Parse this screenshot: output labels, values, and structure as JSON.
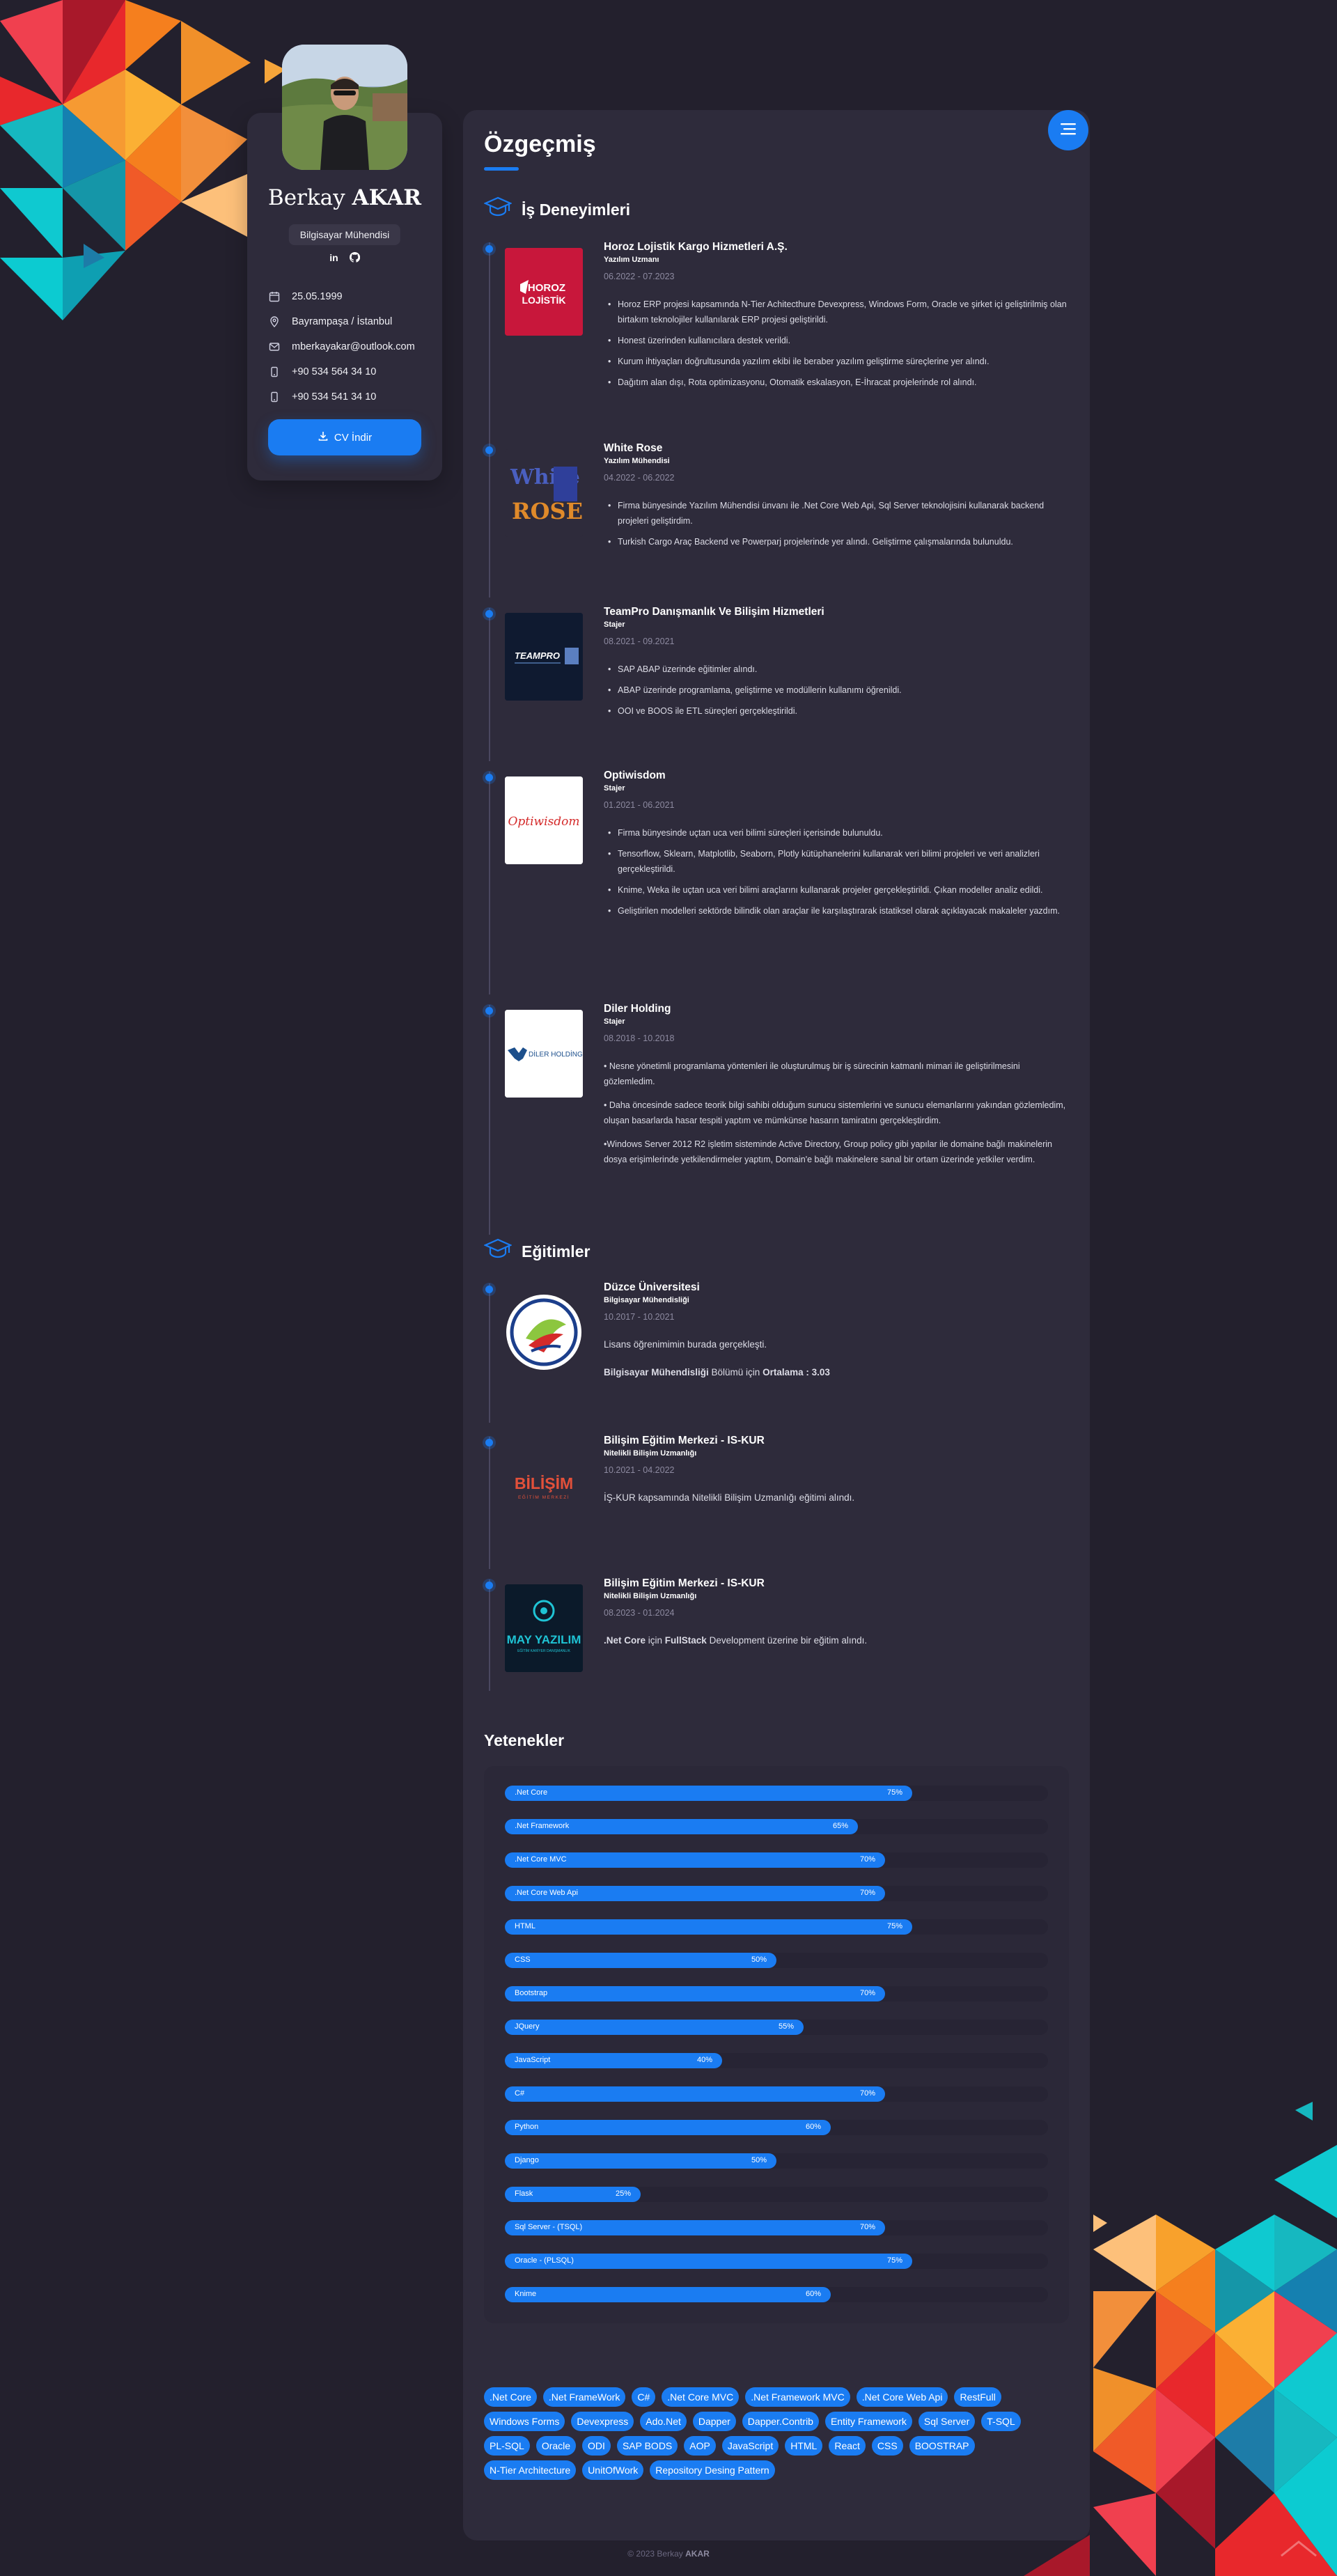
{
  "profile": {
    "first_name": "Berkay",
    "last_name": "AKAR",
    "title": "Bilgisayar Mühendisi",
    "birth": "25.05.1999",
    "location": "Bayrampaşa / İstanbul",
    "email": "mberkayakar@outlook.com",
    "phone1": "+90 534 564 34 10",
    "phone2": "+90 534 541 34 10",
    "cv_button": "CV İndir",
    "social_linkedin": "in",
    "social_github": "github"
  },
  "main": {
    "title": "Özgeçmiş",
    "experience_heading": "İş Deneyimleri",
    "education_heading": "Eğitimler",
    "skills_heading": "Yetenekler"
  },
  "experience": [
    {
      "company": "Horoz Lojistik Kargo Hizmetleri A.Ş.",
      "role": "Yazılım Uzmanı",
      "date": "06.2022 - 07.2023",
      "logo_text": "HOROZ LOJİSTİK",
      "items": [
        "Horoz ERP projesi kapsamında N-Tier Achitecthure Devexpress, Windows Form, Oracle ve şirket içi geliştirilmiş olan birtakım teknolojiler kullanılarak ERP projesi geliştirildi.",
        "Honest üzerinden kullanıcılara destek verildi.",
        "Kurum ihtiyaçları doğrultusunda yazılım ekibi ile beraber yazılım geliştirme süreçlerine yer alındı.",
        "Dağıtım alan dışı, Rota optimizasyonu, Otomatik eskalasyon, E-İhracat projelerinde rol alındı."
      ]
    },
    {
      "company": "White Rose",
      "role": "Yazılım Mühendisi",
      "date": "04.2022 - 06.2022",
      "logo_text": "White ROSE",
      "items": [
        "Firma bünyesinde Yazılım Mühendisi ünvanı ile .Net Core Web Api, Sql Server teknolojisini kullanarak backend projeleri geliştirdim.",
        "Turkish Cargo Araç Backend ve Powerparj projelerinde yer alındı. Geliştirme çalışmalarında bulunuldu."
      ]
    },
    {
      "company": "TeamPro Danışmanlık Ve Bilişim Hizmetleri",
      "role": "Stajer",
      "date": "08.2021 - 09.2021",
      "logo_text": "TEAMPRO",
      "items": [
        "SAP ABAP üzerinde eğitimler alındı.",
        "ABAP üzerinde programlama, geliştirme ve modüllerin kullanımı öğrenildi.",
        "OOI ve BOOS ile ETL süreçleri gerçekleştirildi."
      ]
    },
    {
      "company": "Optiwisdom",
      "role": "Stajer",
      "date": "01.2021 - 06.2021",
      "logo_text": "Optiwisdom",
      "items": [
        "Firma bünyesinde uçtan uca veri bilimi süreçleri içerisinde bulunuldu.",
        "Tensorflow, Sklearn, Matplotlib, Seaborn, Plotly kütüphanelerini kullanarak veri bilimi projeleri ve veri analizleri gerçekleştirildi.",
        "Knime, Weka ile uçtan uca veri bilimi araçlarını kullanarak projeler gerçekleştirildi. Çıkan modeller analiz edildi.",
        "Geliştirilen modelleri sektörde bilindik olan araçlar ile karşılaştırarak istatiksel olarak açıklayacak makaleler yazdım."
      ]
    },
    {
      "company": "Diler Holding",
      "role": "Stajer",
      "date": "08.2018 - 10.2018",
      "logo_text": "DİLER HOLDİNG",
      "paras": [
        "• Nesne yönetimli programlama yöntemleri ile oluşturulmuş bir iş sürecinin katmanlı mimari ile geliştirilmesini gözlemledim.",
        "• Daha öncesinde sadece teorik bilgi sahibi olduğum sunucu sistemlerini ve sunucu elemanlarını yakından gözlemledim, oluşan basarlarda hasar tespiti yaptım ve mümkünse hasarın tamiratını gerçekleştirdim.",
        "•Windows Server 2012 R2 işletim sisteminde Active Directory, Group policy gibi yapılar ile domaine bağlı makinelerin dosya erişimlerinde yetkilendirmeler yaptım, Domain'e bağlı makinelere sanal bir ortam üzerinde yetkiler verdim."
      ]
    }
  ],
  "education": [
    {
      "school": "Düzce Üniversitesi",
      "role": "Bilgisayar Mühendisliği",
      "date": "10.2017 - 10.2021",
      "logo_text": "DÜZCE ÜNİVERSİTESİ",
      "p1": "Lisans öğrenimimin burada gerçekleşti.",
      "p2_a": "Bilgisayar Mühendisliği",
      "p2_b": " Bölümü için ",
      "p2_c": "Ortalama : 3.03"
    },
    {
      "school": "Bilişim Eğitim Merkezi - IS-KUR",
      "role": "Nitelikli Bilişim Uzmanlığı",
      "date": "10.2021 - 04.2022",
      "logo_text": "BİLİŞİM",
      "logo_sub": "EĞİTİM MERKEZİ",
      "p1": "İŞ-KUR kapsamında Nitelikli Bilişim Uzmanlığı eğitimi alındı."
    },
    {
      "school": "Bilişim Eğitim Merkezi - IS-KUR",
      "role": "Nitelikli Bilişim Uzmanlığı",
      "date": "08.2023 - 01.2024",
      "logo_text": "MAY YAZILIM",
      "logo_sub": "EĞİTİM KARİYER DANIŞMANLIK",
      "p1_a": ".Net Core",
      "p1_b": " için ",
      "p1_c": "FullStack",
      "p1_d": " Development üzerine bir eğitim alındı."
    }
  ],
  "skills": [
    {
      "name": ".Net Core",
      "pct": 75,
      "label": "75%"
    },
    {
      "name": ".Net Framework",
      "pct": 65,
      "label": "65%"
    },
    {
      "name": ".Net Core MVC",
      "pct": 70,
      "label": "70%"
    },
    {
      "name": ".Net Core Web Api",
      "pct": 70,
      "label": "70%"
    },
    {
      "name": "HTML",
      "pct": 75,
      "label": "75%"
    },
    {
      "name": "CSS",
      "pct": 50,
      "label": "50%"
    },
    {
      "name": "Bootstrap",
      "pct": 70,
      "label": "70%"
    },
    {
      "name": "JQuery",
      "pct": 55,
      "label": "55%"
    },
    {
      "name": "JavaScript",
      "pct": 40,
      "label": "40%"
    },
    {
      "name": "C#",
      "pct": 70,
      "label": "70%"
    },
    {
      "name": "Python",
      "pct": 60,
      "label": "60%"
    },
    {
      "name": "Django",
      "pct": 50,
      "label": "50%"
    },
    {
      "name": "Flask",
      "pct": 25,
      "label": "25%"
    },
    {
      "name": "Sql Server - (TSQL)",
      "pct": 70,
      "label": "70%"
    },
    {
      "name": "Oracle - (PLSQL)",
      "pct": 75,
      "label": "75%"
    },
    {
      "name": "Knime",
      "pct": 60,
      "label": "60%"
    }
  ],
  "tags": [
    ".Net Core",
    ".Net FrameWork",
    "C#",
    ".Net Core MVC",
    ".Net Framework MVC",
    ".Net Core Web Api",
    "RestFull",
    "Windows Forms",
    "Devexpress",
    "Ado.Net",
    "Dapper",
    "Dapper.Contrib",
    "Entity Framework",
    "Sql Server",
    "T-SQL",
    "PL-SQL",
    "Oracle",
    "ODI",
    "SAP BODS",
    "AOP",
    "JavaScript",
    "HTML",
    "React",
    "CSS",
    "BOOSTRAP",
    "N-Tier Architecture",
    "UnitOfWork",
    "Repository Desing Pattern"
  ],
  "footer": {
    "prefix": "© 2023 Berkay ",
    "name": "AKAR"
  },
  "colors": {
    "accent": "#1a7cf2",
    "background": "#23202d",
    "card": "#2e2b3b"
  }
}
